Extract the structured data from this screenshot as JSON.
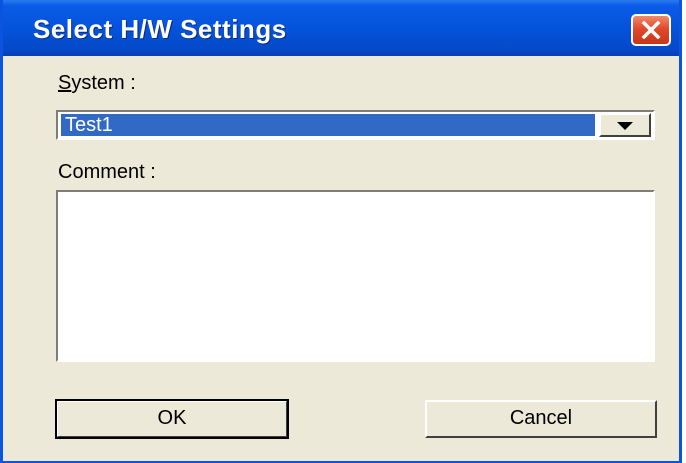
{
  "window": {
    "title": "Select H/W Settings"
  },
  "system": {
    "label_underlined": "S",
    "label_rest": "ystem :",
    "value": "Test1"
  },
  "comment": {
    "label": "Comment :",
    "value": ""
  },
  "buttons": {
    "ok_label": "OK",
    "cancel_label": "Cancel"
  },
  "colors": {
    "titlebar": "#0553dc",
    "selection": "#316ac5",
    "face": "#ece9d8",
    "close": "#e04a2a"
  },
  "icons": {
    "close": "close-icon",
    "dropdown": "chevron-down-icon"
  }
}
